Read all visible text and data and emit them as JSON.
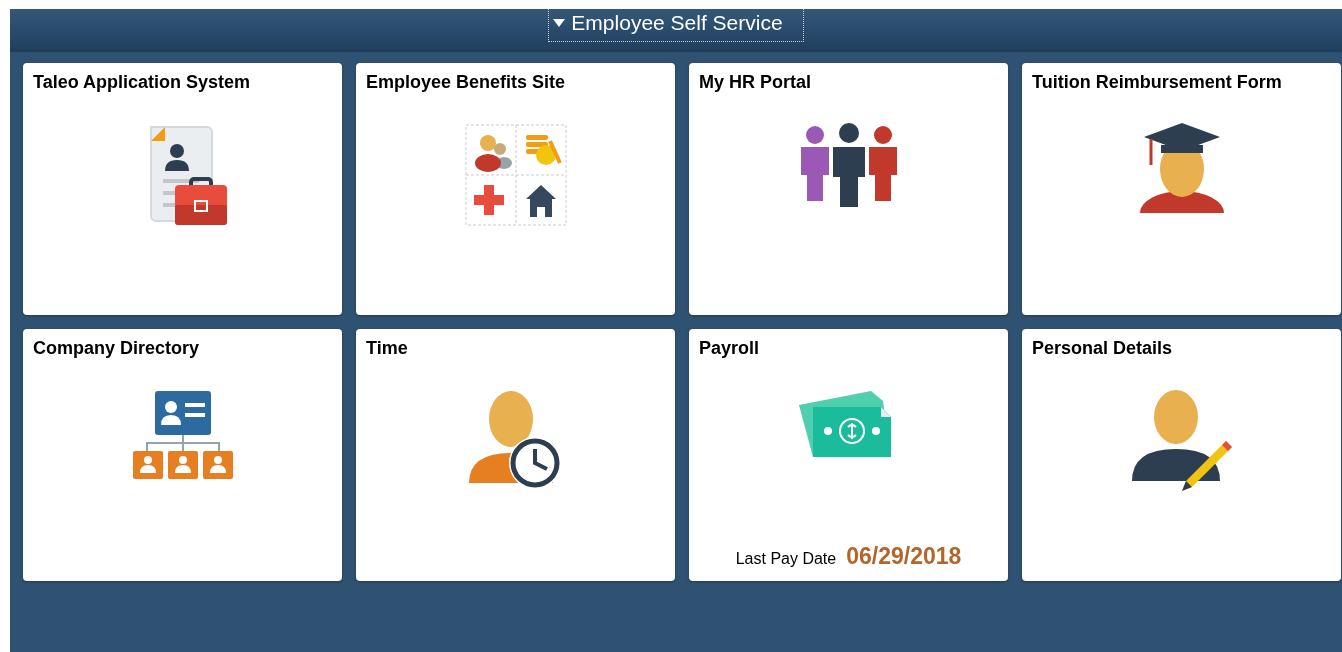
{
  "header": {
    "title": "Employee Self Service",
    "expanded": true
  },
  "tiles": [
    {
      "title": "Taleo Application System",
      "kind": "resume"
    },
    {
      "title": "Employee Benefits Site",
      "kind": "benefits"
    },
    {
      "title": "My HR Portal",
      "kind": "people"
    },
    {
      "title": "Tuition Reimbursement Form",
      "kind": "graduate"
    },
    {
      "title": "Company Directory",
      "kind": "orgchart"
    },
    {
      "title": "Time",
      "kind": "time"
    },
    {
      "title": "Payroll",
      "kind": "money",
      "detail": {
        "label": "Last Pay Date",
        "value": "06/29/2018"
      }
    },
    {
      "title": "Personal Details",
      "kind": "editor"
    }
  ]
}
